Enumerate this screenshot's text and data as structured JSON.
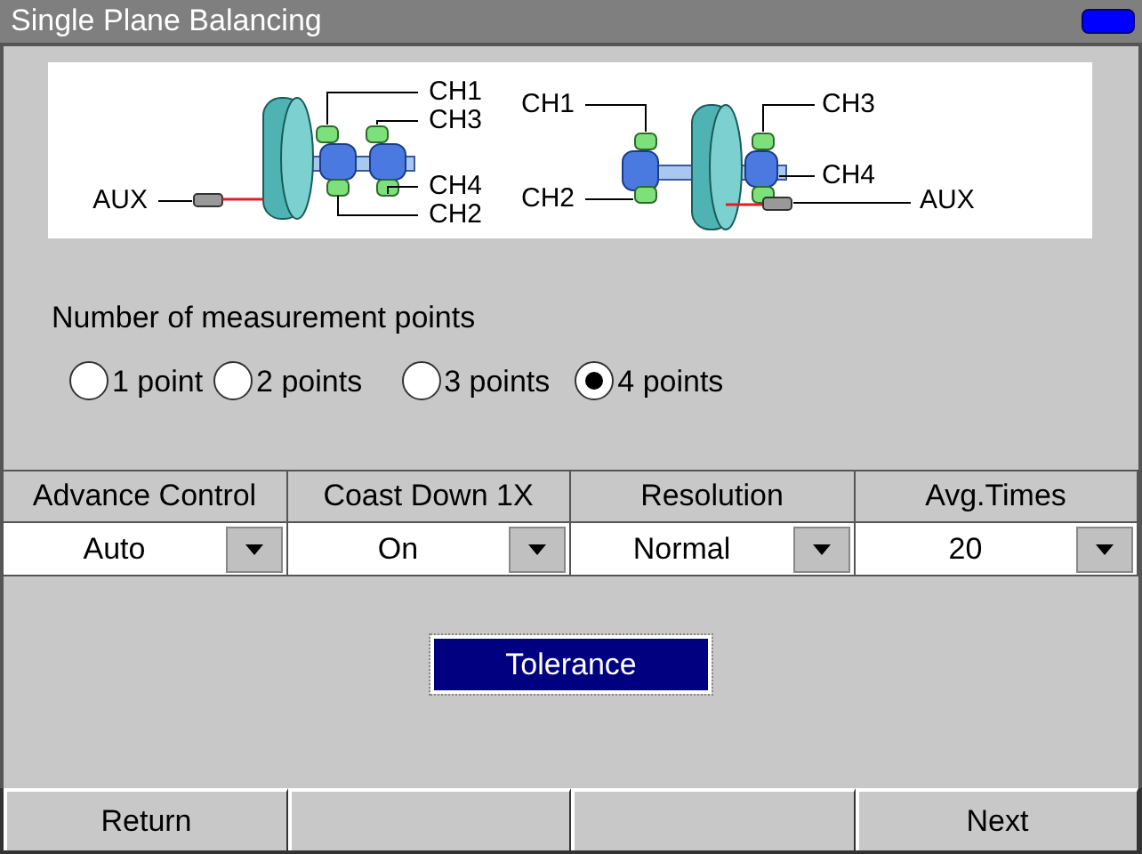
{
  "window": {
    "title": "Single Plane Balancing"
  },
  "diagram": {
    "left_labels": [
      "CH1",
      "CH3",
      "CH4",
      "CH2",
      "AUX"
    ],
    "right_labels": [
      "CH1",
      "CH2",
      "CH3",
      "CH4",
      "AUX"
    ]
  },
  "measurement_points": {
    "label": "Number of measurement points",
    "options": [
      {
        "label": "1 point",
        "selected": false
      },
      {
        "label": "2 points",
        "selected": false
      },
      {
        "label": "3 points",
        "selected": false
      },
      {
        "label": "4 points",
        "selected": true
      }
    ]
  },
  "settings": [
    {
      "header": "Advance Control",
      "value": "Auto"
    },
    {
      "header": "Coast Down 1X",
      "value": "On"
    },
    {
      "header": "Resolution",
      "value": "Normal"
    },
    {
      "header": "Avg.Times",
      "value": "20"
    }
  ],
  "tolerance_button": {
    "label": "Tolerance"
  },
  "softkeys": [
    {
      "kind": "label",
      "label": "Return"
    },
    {
      "kind": "blank"
    },
    {
      "kind": "blank"
    },
    {
      "kind": "label",
      "label": "Next"
    }
  ]
}
